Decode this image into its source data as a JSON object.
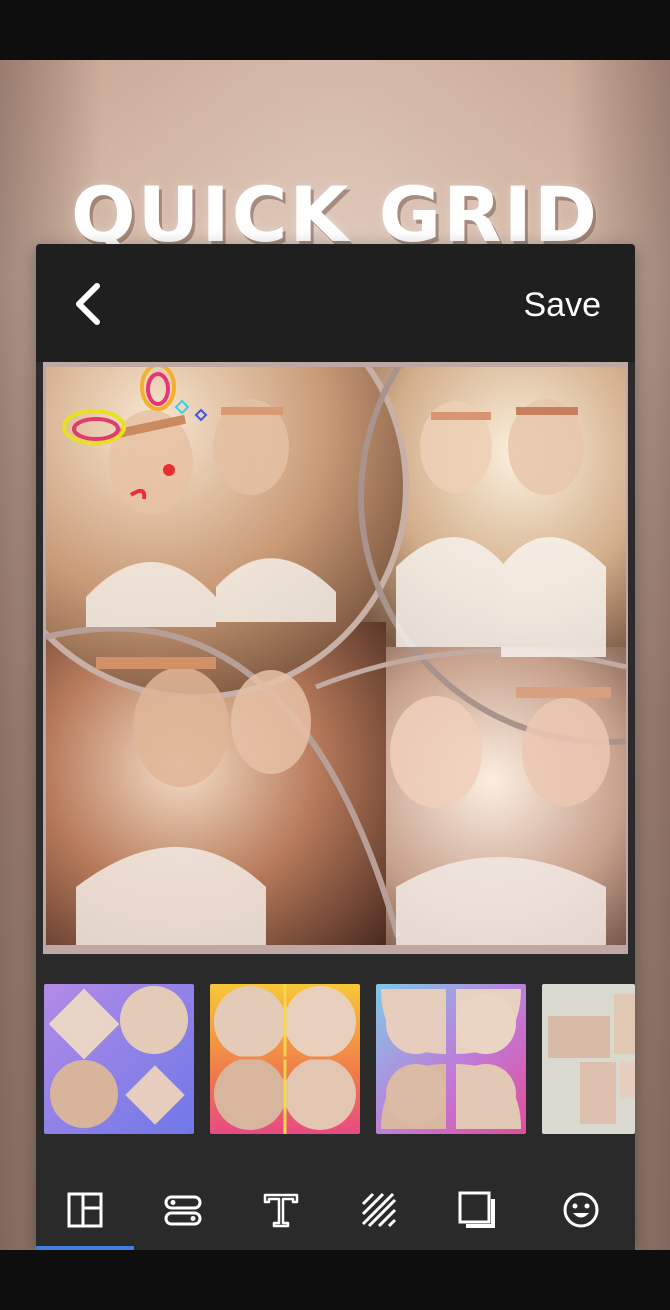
{
  "banner": {
    "headline": "QUICK GRID"
  },
  "editor": {
    "save_label": "Save",
    "back_icon": "chevron-left-icon"
  },
  "templates": [
    {
      "name": "diamond-circle-mix",
      "accent": "#8f7fe0"
    },
    {
      "name": "circle-quad-yellow",
      "accent": "#f2a43a"
    },
    {
      "name": "petal-quad-purple",
      "accent": "#b46ed2"
    },
    {
      "name": "staggered-grey",
      "accent": "#d9d9cf"
    }
  ],
  "toolbar": {
    "tools": [
      {
        "icon": "layout-icon",
        "active": true
      },
      {
        "icon": "spacing-icon",
        "active": false
      },
      {
        "icon": "text-icon",
        "active": false
      },
      {
        "icon": "pattern-icon",
        "active": false
      },
      {
        "icon": "frame-icon",
        "active": false
      },
      {
        "icon": "sticker-icon",
        "active": false
      }
    ],
    "accent": "#3f7fe0"
  }
}
